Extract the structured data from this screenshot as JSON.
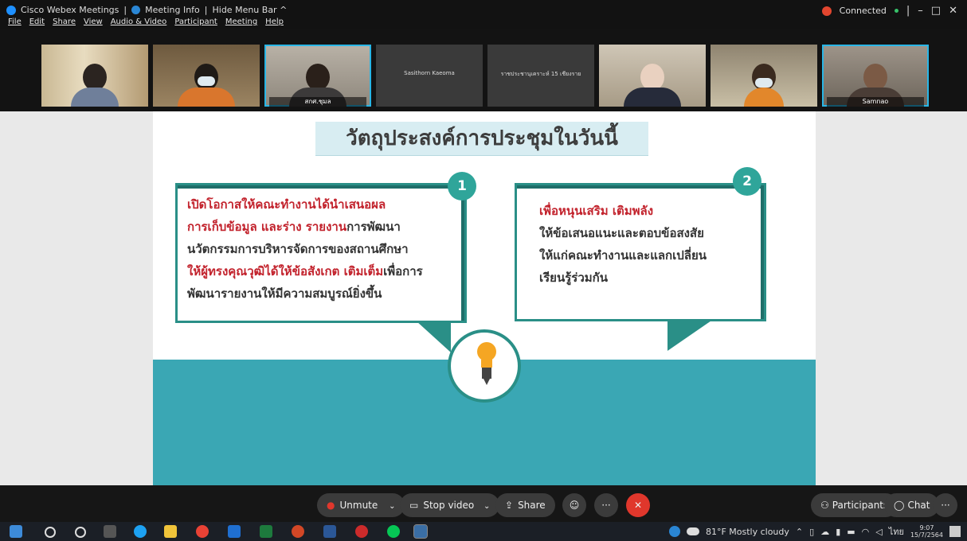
{
  "titlebar": {
    "app_name": "Cisco Webex Meetings",
    "meeting_info": "Meeting Info",
    "hide_menu": "Hide Menu Bar ^",
    "connection": "Connected",
    "minimize": "–",
    "restore": "□",
    "close": "✕",
    "separator": "|"
  },
  "menu": [
    "File",
    "Edit",
    "Share",
    "View",
    "Audio & Video",
    "Participant",
    "Meeting",
    "Help"
  ],
  "participants": [
    {
      "name": ""
    },
    {
      "name": ""
    },
    {
      "name": "สกศ.ชุมล"
    },
    {
      "name": "Sasithorn Kaeoma"
    },
    {
      "name": "ราชประชานุเคราะห์ 15 เชียงราย"
    },
    {
      "name": ""
    },
    {
      "name": ""
    },
    {
      "name": "Samnao"
    }
  ],
  "slide": {
    "title": "วัตถุประสงค์การประชุมในวันนี้",
    "box1_badge": "1",
    "box2_badge": "2",
    "box1_lines": [
      {
        "red": "เปิดโอกาสให้คณะทำงานได้นำเสนอผล",
        "dark": ""
      },
      {
        "red": "การเก็บข้อมูล และร่าง รายงาน",
        "dark": "การพัฒนา"
      },
      {
        "red": "",
        "dark": "นวัตกรรมการบริหารจัดการของสถานศึกษา"
      },
      {
        "red": "ให้ผู้ทรงคุณวุฒิได้ให้ข้อสังเกต เติมเต็ม",
        "dark": "เพื่อการ"
      },
      {
        "red": "",
        "dark": "พัฒนารายงานให้มีความสมบูรณ์ยิ่งขึ้น"
      }
    ],
    "box2_lines": [
      {
        "red": "เพื่อหนุนเสริม เติมพลัง",
        "dark": ""
      },
      {
        "red": "",
        "dark": "ให้ข้อเสนอแนะและตอบข้อสงสัย"
      },
      {
        "red": "",
        "dark": "ให้แก่คณะทำงานและแลกเปลี่ยน"
      },
      {
        "red": "",
        "dark": "เรียนรู้ร่วมกัน"
      }
    ]
  },
  "controls": {
    "unmute": "Unmute",
    "stop_video": "Stop video",
    "share": "Share",
    "participants": "Participants",
    "chat": "Chat",
    "more": "···",
    "chevron": "⌄",
    "end": "✕"
  },
  "taskbar": {
    "weather": "81°F  Mostly cloudy",
    "lang": "ไทย",
    "time": "9:07",
    "date": "15/7/2564"
  },
  "colors": {
    "accent_teal": "#2a8f87",
    "band": "#3aa7b4",
    "end_red": "#e0372c"
  }
}
